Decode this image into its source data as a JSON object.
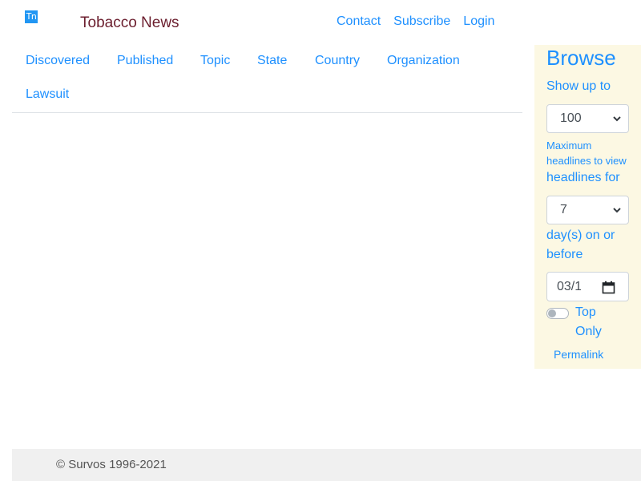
{
  "header": {
    "logo_text": "Tn",
    "brand": "Tobacco News",
    "links": [
      "Contact",
      "Subscribe",
      "Login"
    ]
  },
  "nav": {
    "items": [
      "Discovered",
      "Published",
      "Topic",
      "State",
      "Country",
      "Organization",
      "Lawsuit"
    ]
  },
  "sidebar": {
    "title": "Browse",
    "show_up_to": "Show up to",
    "max_value": "100",
    "max_help": "Maximum headlines to view",
    "headlines_for": "headlines for",
    "days_value": "7",
    "days_label": "day(s) on or before",
    "date_value": "03/1",
    "toggle_label": "Top Only",
    "permalink": "Permalink"
  },
  "footer": {
    "copyright": "© Survos 1996-2021"
  },
  "colors": {
    "link": "#1e90ff",
    "brand": "#6b1e2e",
    "sidebar_bg": "#fcf8e3",
    "footer_bg": "#f0f0f0"
  }
}
